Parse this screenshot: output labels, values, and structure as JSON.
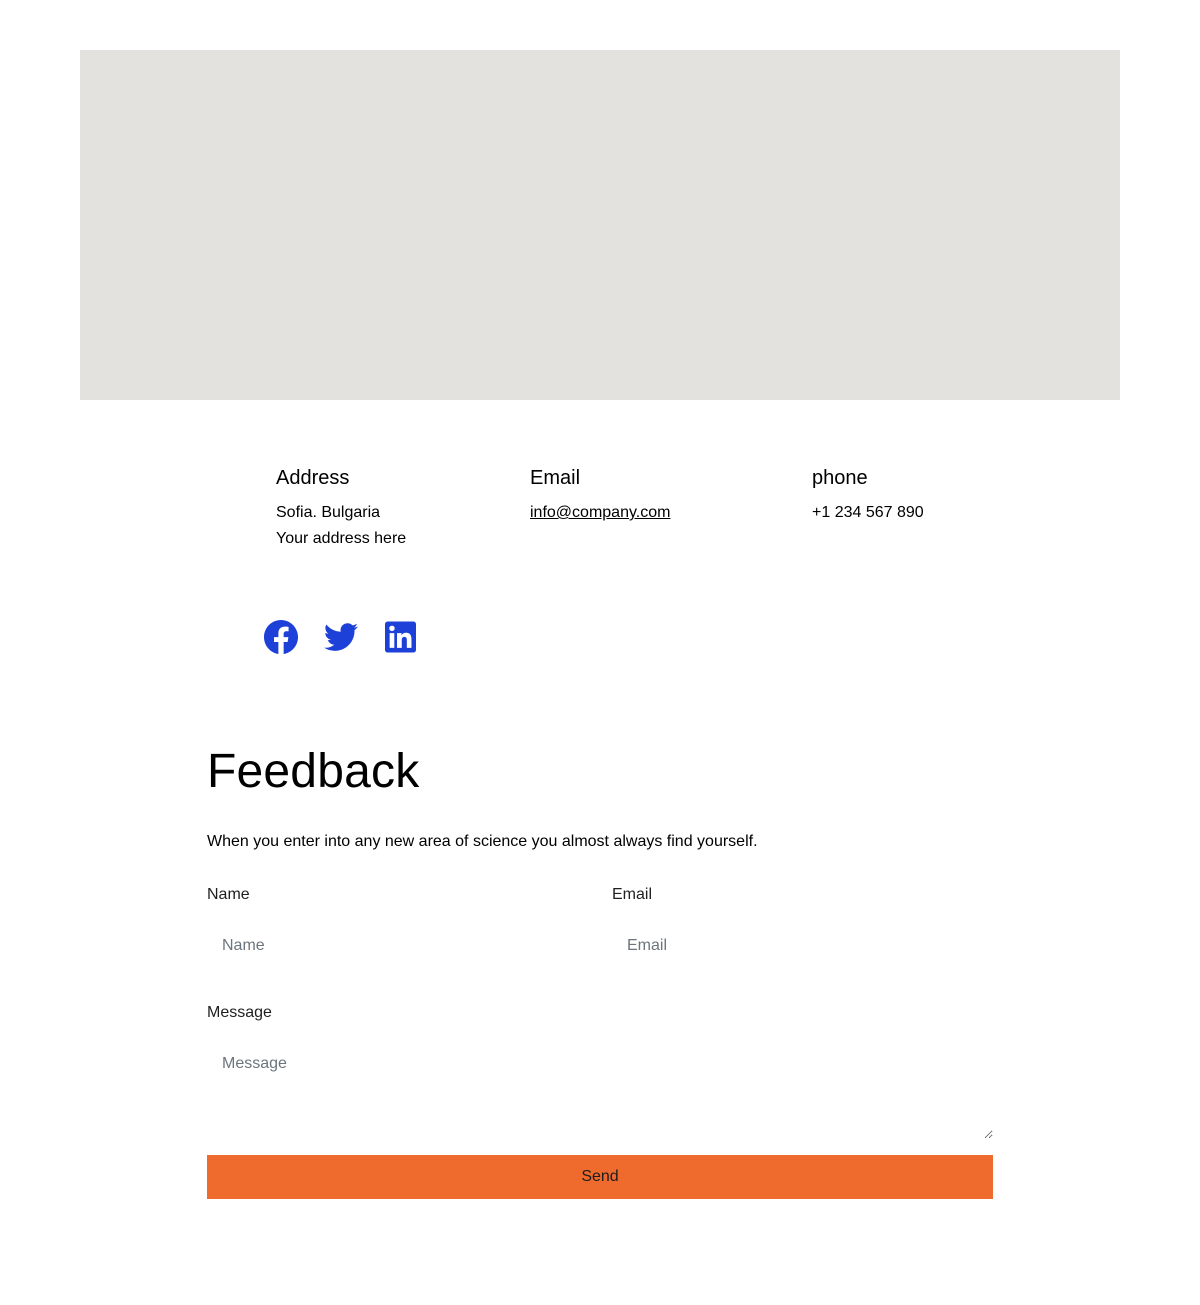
{
  "map": {
    "background": "#e3e2de"
  },
  "contact": {
    "address": {
      "heading": "Address",
      "line1": "Sofia. Bulgaria",
      "line2": "Your address here"
    },
    "email": {
      "heading": "Email",
      "value": "info@company.com"
    },
    "phone": {
      "heading": "phone",
      "value": "+1 234 567 890"
    }
  },
  "socials": {
    "accent": "#1d40d8",
    "items": [
      "facebook-icon",
      "twitter-icon",
      "linkedin-icon"
    ]
  },
  "feedback": {
    "title": "Feedback",
    "intro": "When you enter into any new area of science you almost always find yourself.",
    "name_label": "Name",
    "name_placeholder": "Name",
    "email_label": "Email",
    "email_placeholder": "Email",
    "message_label": "Message",
    "message_placeholder": "Message",
    "send_label": "Send",
    "button_color": "#ee6b2d"
  }
}
